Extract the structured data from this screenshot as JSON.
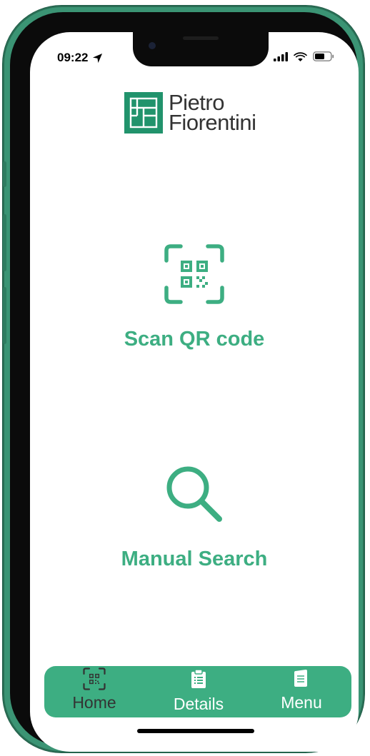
{
  "status_bar": {
    "time": "09:22",
    "location_icon": "location-arrow-icon",
    "signal_icon": "cellular-signal-icon",
    "wifi_icon": "wifi-icon",
    "battery_icon": "battery-icon"
  },
  "brand": {
    "name_line1": "Pietro",
    "name_line2": "Fiorentini",
    "logo_icon": "pietro-fiorentini-logo-icon",
    "color": "#21936c"
  },
  "actions": {
    "scan": {
      "label": "Scan QR code",
      "icon": "qr-code-icon"
    },
    "search": {
      "label": "Manual Search",
      "icon": "magnifier-icon"
    }
  },
  "tabbar": {
    "tabs": [
      {
        "label": "Home",
        "icon": "qr-code-icon",
        "active": true
      },
      {
        "label": "Details",
        "icon": "clipboard-icon",
        "active": false
      },
      {
        "label": "Menu",
        "icon": "document-icon",
        "active": false
      }
    ]
  },
  "colors": {
    "accent": "#3dae82",
    "active_tab_text": "#333333",
    "inactive_tab_text": "#ffffff",
    "frame": "#3b9474"
  }
}
